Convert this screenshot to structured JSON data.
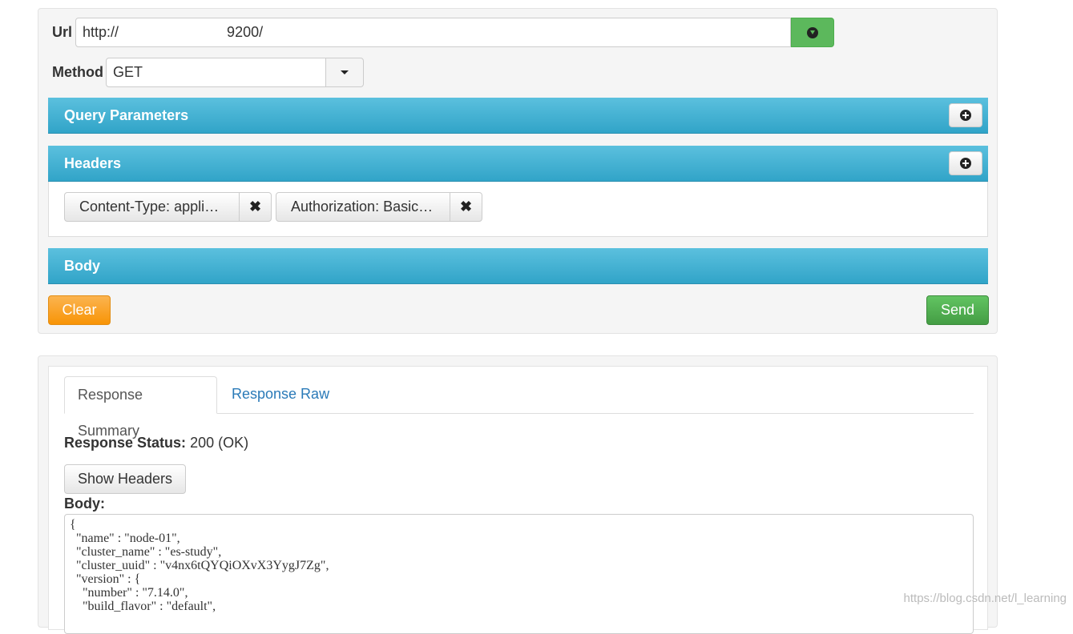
{
  "request": {
    "url_label": "Url",
    "url_value": "http://                           9200/",
    "method_label": "Method",
    "method_value": "GET",
    "query_params_title": "Query Parameters",
    "headers_title": "Headers",
    "headers": [
      {
        "text": "Content-Type: applic…"
      },
      {
        "text": "Authorization: Basic …"
      }
    ],
    "body_title": "Body",
    "clear_label": "Clear",
    "send_label": "Send"
  },
  "response": {
    "tabs": [
      {
        "label": "Response Summary"
      },
      {
        "label": "Response Raw"
      }
    ],
    "status_label": "Response Status:",
    "status_value": "200 (OK)",
    "show_headers_label": "Show Headers",
    "body_label": "Body:",
    "body_text": "{\n  \"name\" : \"node-01\",\n  \"cluster_name\" : \"es-study\",\n  \"cluster_uuid\" : \"v4nx6tQYQiOXvX3YygJ7Zg\",\n  \"version\" : {\n    \"number\" : \"7.14.0\",\n    \"build_flavor\" : \"default\","
  },
  "watermark": "https://blog.csdn.net/l_learning",
  "icons": {
    "url_submit": "download-circle-icon",
    "add": "plus-circle-icon",
    "remove": "close-icon",
    "dropdown": "caret-down-icon"
  },
  "colors": {
    "accent_bar": "#31a4c8",
    "clear": "#f89406",
    "send": "#449d44",
    "link": "#2a7ab8"
  }
}
